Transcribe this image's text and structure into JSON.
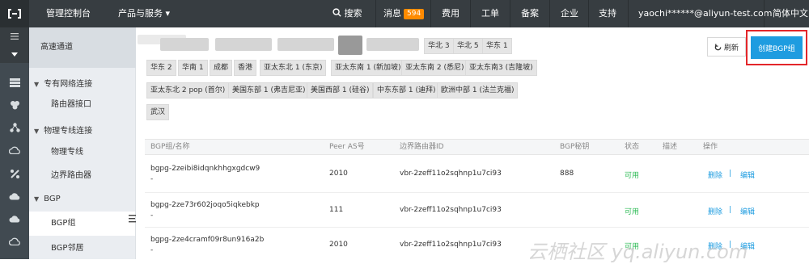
{
  "topbar": {
    "console": "管理控制台",
    "products": "产品与服务",
    "products_caret": "▾",
    "search": "搜索",
    "messages": "消息",
    "messages_count": "594",
    "billing": "费用",
    "tickets": "工单",
    "icp": "备案",
    "enterprise": "企业",
    "support": "支持",
    "user": "yaochi******@aliyun-test.com",
    "language": "简体中文"
  },
  "sidenav": {
    "title": "高速通道",
    "groups": [
      {
        "label": "专有网络连接",
        "items": [
          "路由器接口"
        ]
      },
      {
        "label": "物理专线连接",
        "items": [
          "物理专线",
          "边界路由器"
        ]
      },
      {
        "label": "BGP",
        "items": [
          "BGP组",
          "BGP邻居"
        ]
      }
    ]
  },
  "regions": {
    "row1": [
      "华北 3",
      "华北 5",
      "华东 1"
    ],
    "row2": [
      "华东 2",
      "华南 1",
      "成都",
      "香港",
      "亚太东北 1 (东京)",
      "亚太东南 1 (新加坡)",
      "亚太东南 2 (悉尼)",
      "亚太东南3 (吉隆坡)"
    ],
    "row3": [
      "亚太东北 2 pop (首尔)",
      "美国东部 1 (弗吉尼亚)",
      "美国西部 1 (硅谷)",
      "中东东部 1 (迪拜)",
      "欧洲中部 1 (法兰克福)"
    ],
    "row4": [
      "武汉"
    ]
  },
  "actions": {
    "refresh": "刷新",
    "create": "创建BGP组"
  },
  "table": {
    "headers": [
      "BGP组/名称",
      "Peer AS号",
      "边界路由器ID",
      "BGP秘钥",
      "状态",
      "描述",
      "操作"
    ],
    "rows": [
      {
        "id": "bgpg-2zeibi8idqnkhhgxgdcw9",
        "name": "-",
        "peer_as": "2010",
        "vbr": "vbr-2zeff11o2sqhnp1u7ci93",
        "key": "888",
        "status": "可用",
        "desc": "",
        "delete": "删除",
        "edit": "编辑"
      },
      {
        "id": "bgpg-2ze73r602joqo5iqkebkp",
        "name": "-",
        "peer_as": "111",
        "vbr": "vbr-2zeff11o2sqhnp1u7ci93",
        "key": "",
        "status": "可用",
        "desc": "",
        "delete": "删除",
        "edit": "编辑"
      },
      {
        "id": "bgpg-2ze4cramf09r8un916a2b",
        "name": "-",
        "peer_as": "2010",
        "vbr": "vbr-2zeff11o2sqhnp1u7ci93",
        "key": "",
        "status": "可用",
        "desc": "",
        "delete": "删除",
        "edit": "编辑"
      }
    ],
    "op_separator": "|"
  },
  "watermark": "云栖社区 yq.aliyun.com",
  "colors": {
    "accent": "#1e9ce0",
    "ok": "#2dbb55",
    "highlight_border": "#e3262a",
    "topbar": "#373d41",
    "badge": "#ff8a00"
  }
}
